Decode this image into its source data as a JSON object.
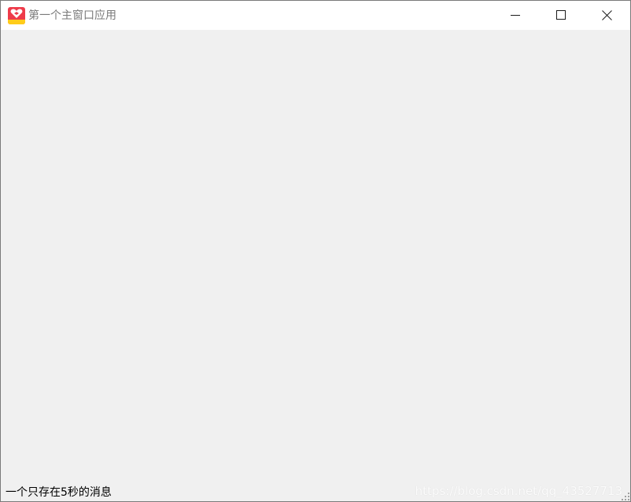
{
  "window": {
    "title": "第一个主窗口应用",
    "icon": "app-logo-icon",
    "controls": {
      "minimize": "minimize-icon",
      "maximize": "maximize-icon",
      "close": "close-icon"
    }
  },
  "statusbar": {
    "message": "一个只存在5秒的消息",
    "watermark": "https://blog.csdn.net/qq_43527713"
  },
  "colors": {
    "titlebar_bg": "#ffffff",
    "client_bg": "#f0f0f0",
    "title_text": "#7a7a7a",
    "icon_red": "#ee3b4a",
    "icon_yellow": "#ffcc1a"
  }
}
